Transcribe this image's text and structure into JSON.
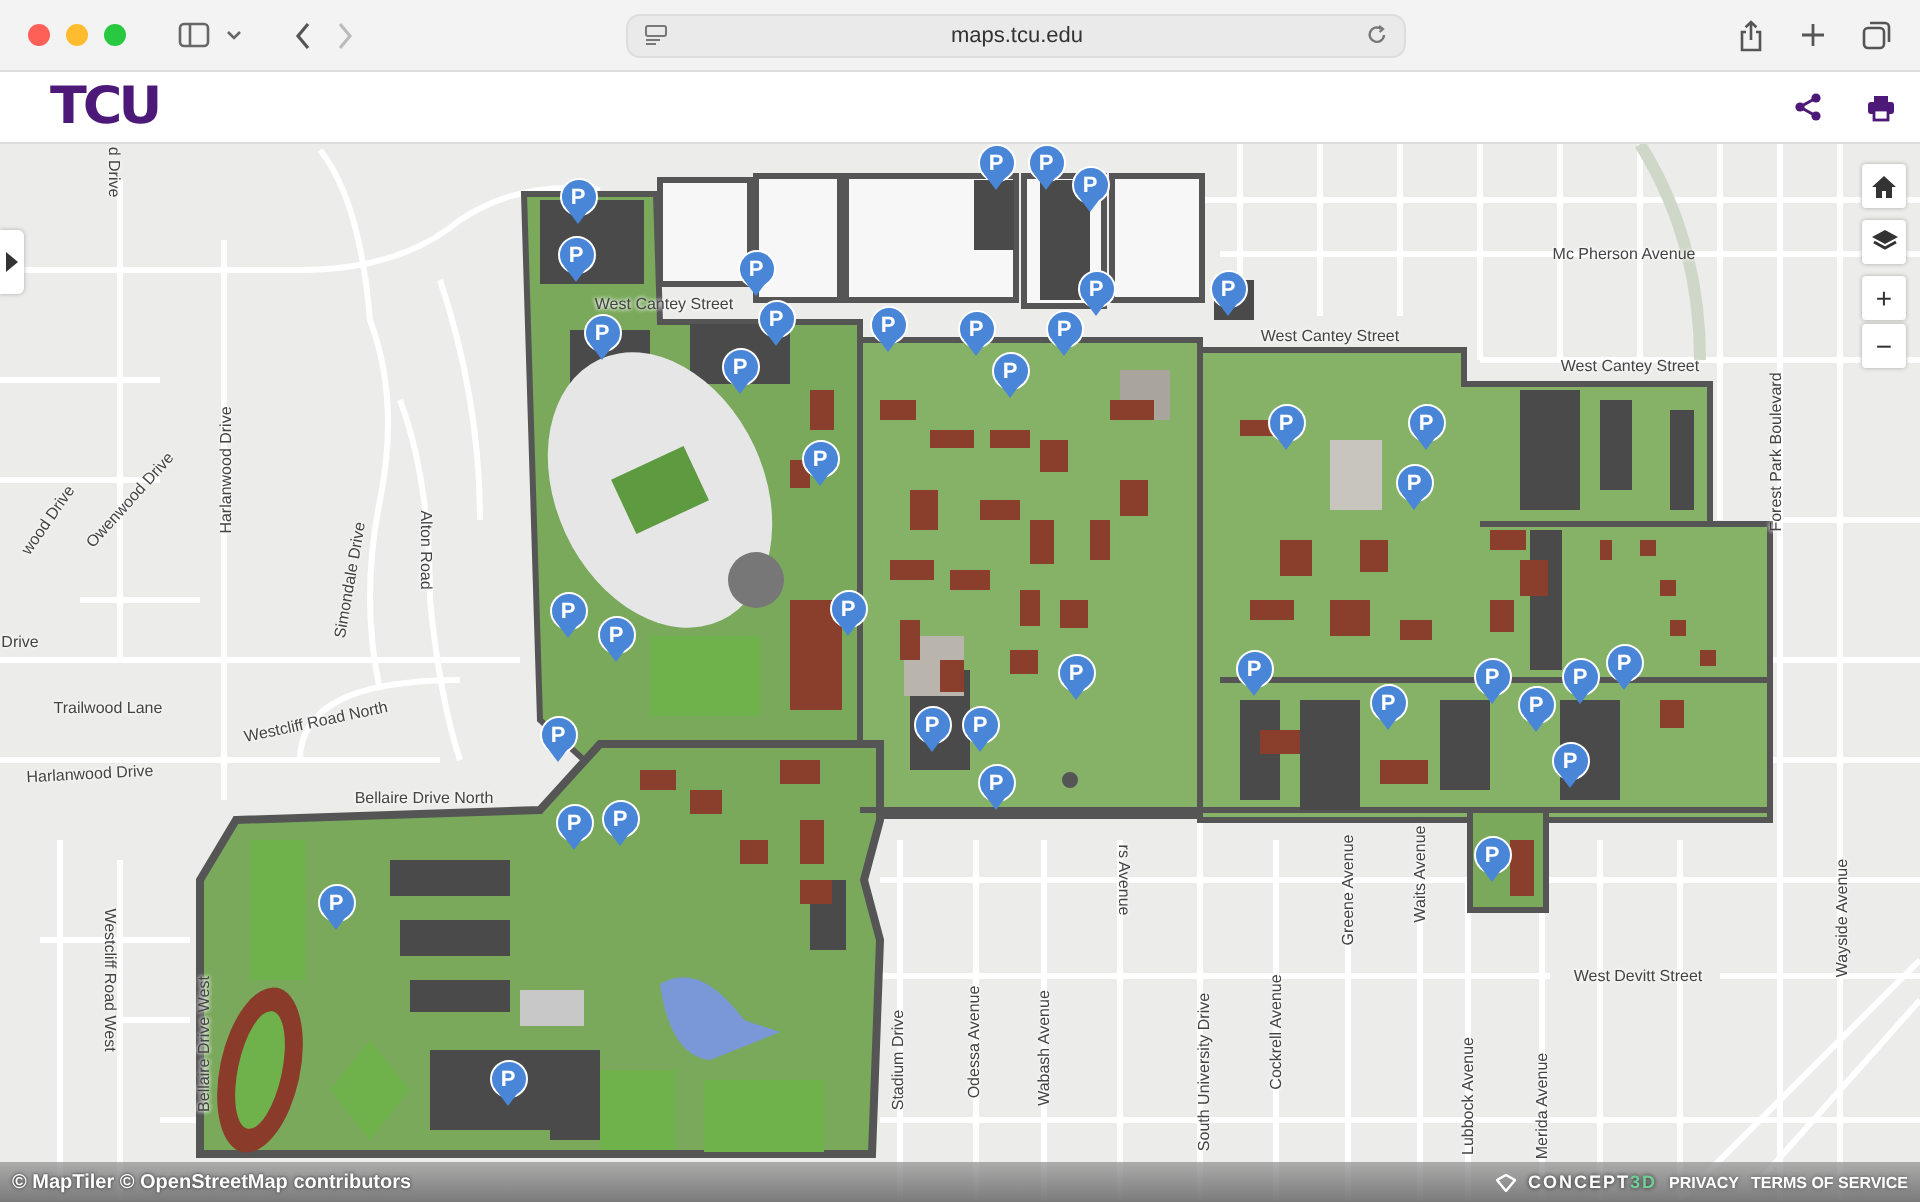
{
  "browser": {
    "url": "maps.tcu.edu"
  },
  "header": {
    "logo": "TCU"
  },
  "map": {
    "streets": [
      {
        "name": "d Drive"
      },
      {
        "name": "Harlanwood Drive"
      },
      {
        "name": "Owenwood Drive"
      },
      {
        "name": "wood Drive"
      },
      {
        "name": "Drive"
      },
      {
        "name": "Trailwood Lane"
      },
      {
        "name": "Harlanwood Drive"
      },
      {
        "name": "Simondale Drive"
      },
      {
        "name": "Alton Road"
      },
      {
        "name": "Westcliff Road North"
      },
      {
        "name": "Mc Pherson Avenue"
      },
      {
        "name": "West Cantey Street"
      },
      {
        "name": "West Cantey Street"
      },
      {
        "name": "West Cantey Street"
      },
      {
        "name": "Forest Park Boulevard"
      },
      {
        "name": "Bellaire Drive North"
      },
      {
        "name": "Westcliff Road West"
      },
      {
        "name": "Bellaire Drive West"
      },
      {
        "name": "Stadium Drive"
      },
      {
        "name": "Odessa Avenue"
      },
      {
        "name": "Wabash Avenue"
      },
      {
        "name": "South University Drive"
      },
      {
        "name": "Cockrell Avenue"
      },
      {
        "name": "Greene Avenue"
      },
      {
        "name": "Waits Avenue"
      },
      {
        "name": "Lubbock Avenue"
      },
      {
        "name": "Merida Avenue"
      },
      {
        "name": "West Devitt Street"
      },
      {
        "name": "Wayside Avenue"
      },
      {
        "name": "rs Avenue"
      }
    ],
    "parking": [
      {
        "label": "P"
      },
      {
        "label": "P"
      },
      {
        "label": "P"
      },
      {
        "label": "P"
      },
      {
        "label": "P"
      },
      {
        "label": "P"
      },
      {
        "label": "P"
      },
      {
        "label": "P"
      },
      {
        "label": "P"
      },
      {
        "label": "P"
      },
      {
        "label": "P"
      },
      {
        "label": "P"
      },
      {
        "label": "P"
      },
      {
        "label": "P"
      },
      {
        "label": "P"
      },
      {
        "label": "P"
      },
      {
        "label": "P"
      },
      {
        "label": "P"
      },
      {
        "label": "P"
      },
      {
        "label": "P"
      },
      {
        "label": "P"
      },
      {
        "label": "P"
      },
      {
        "label": "P"
      },
      {
        "label": "P"
      },
      {
        "label": "P"
      },
      {
        "label": "P"
      },
      {
        "label": "P"
      },
      {
        "label": "P"
      },
      {
        "label": "P"
      },
      {
        "label": "P"
      },
      {
        "label": "P"
      },
      {
        "label": "P"
      },
      {
        "label": "P"
      },
      {
        "label": "P"
      },
      {
        "label": "P"
      },
      {
        "label": "P"
      },
      {
        "label": "P"
      },
      {
        "label": "P"
      },
      {
        "label": "P"
      }
    ],
    "controls": [
      {
        "kind": "home"
      },
      {
        "kind": "layers"
      },
      {
        "kind": "zoom_in",
        "label": "+"
      },
      {
        "kind": "zoom_out",
        "label": "−"
      }
    ],
    "attribution": "© MapTiler © OpenStreetMap contributors",
    "brand": {
      "text": "CONCEPT",
      "accent": "3D"
    },
    "footer_links": [
      "PRIVACY",
      "TERMS OF SERVICE"
    ]
  }
}
